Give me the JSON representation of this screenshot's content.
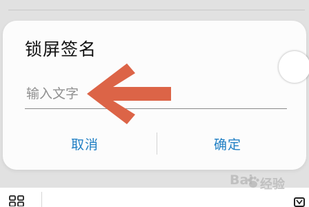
{
  "dialog": {
    "title": "锁屏签名",
    "input_placeholder": "输入文字",
    "input_value": "",
    "cancel_label": "取消",
    "ok_label": "确定"
  },
  "watermark": {
    "brand": "Bai",
    "suffix": "经验"
  },
  "colors": {
    "accent": "#1f7fc4",
    "arrow": "#dc6447",
    "dialog_bg": "#fcfcfc",
    "page_bg": "#e1e1e1"
  },
  "icons": [
    "toggle-knob",
    "left-arrow-annotation",
    "grid-icon",
    "collapse-icon",
    "baidu-paw-icon"
  ]
}
